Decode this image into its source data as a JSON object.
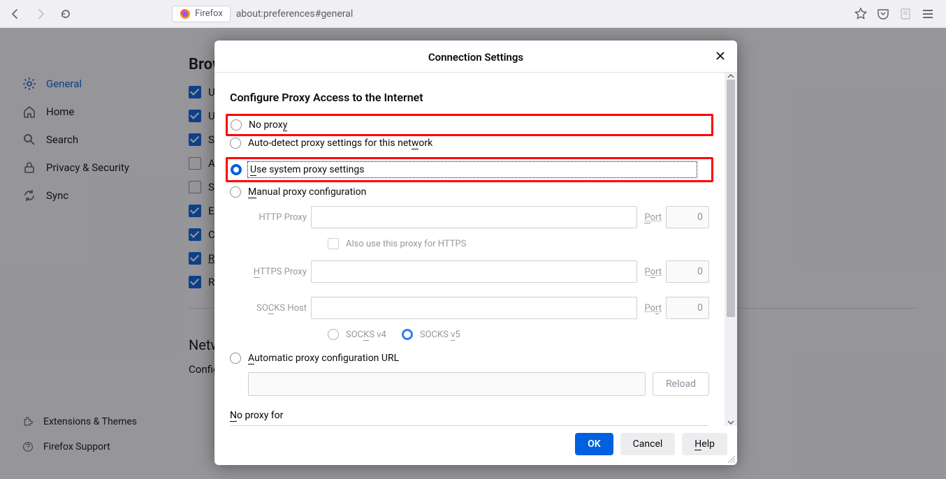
{
  "toolbar": {
    "tab_label": "Firefox",
    "url": "about:preferences#general"
  },
  "sidebar": {
    "items": [
      {
        "label": "General"
      },
      {
        "label": "Home"
      },
      {
        "label": "Search"
      },
      {
        "label": "Privacy & Security"
      },
      {
        "label": "Sync"
      }
    ],
    "bottom": [
      {
        "label": "Extensions & Themes"
      },
      {
        "label": "Firefox Support"
      }
    ]
  },
  "content": {
    "heading_cut": "Brow",
    "rows": [
      {
        "checked": true,
        "label_cut": "Us"
      },
      {
        "checked": true,
        "label_cut": "Us"
      },
      {
        "checked": true,
        "label_cut": "Sh"
      },
      {
        "checked": false,
        "label_cut": "Al"
      },
      {
        "checked": false,
        "label_cut": "Se"
      },
      {
        "checked": true,
        "label_cut": "En"
      },
      {
        "checked": true,
        "label_cut": "Co"
      },
      {
        "checked": true,
        "label_cut": "Re"
      },
      {
        "checked": true,
        "label_cut": "Re"
      }
    ],
    "network_heading_cut": "Netw",
    "config_line_cut": "Config"
  },
  "dialog": {
    "title": "Connection Settings",
    "subheading": "Configure Proxy Access to the Internet",
    "radios": {
      "no_proxy": "No proxy",
      "auto_detect": "Auto-detect proxy settings for this network",
      "use_system": "Use system proxy settings",
      "manual": "Manual proxy configuration",
      "automatic_url": "Automatic proxy configuration URL"
    },
    "proxy": {
      "http_label": "HTTP Proxy",
      "https_label": "HTTPS Proxy",
      "socks_label": "SOCKS Host",
      "port_label": "Port",
      "port_value": "0",
      "also_https": "Also use this proxy for HTTPS",
      "socks_v4": "SOCKS v4",
      "socks_v5": "SOCKS v5"
    },
    "reload_label": "Reload",
    "no_proxy_for": "No proxy for",
    "buttons": {
      "ok": "OK",
      "cancel": "Cancel",
      "help": "Help"
    }
  }
}
